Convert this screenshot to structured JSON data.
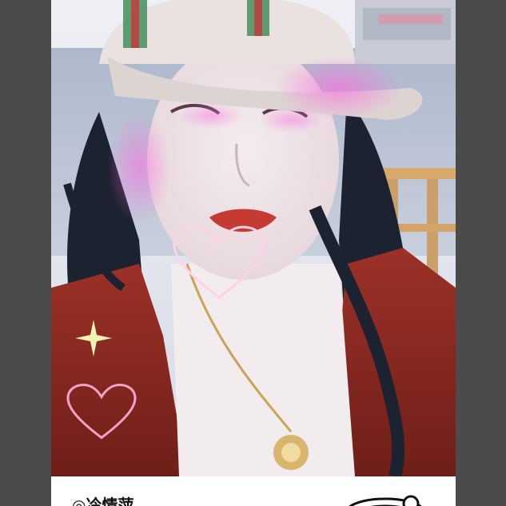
{
  "caption": {
    "text": "◎冷情萍"
  },
  "colors": {
    "outer_background": "#4a4b4a",
    "card_background": "#ffffff",
    "jacket": "#8c2a22",
    "hair": "#1c2230",
    "heart_glitter": "#ff4fd8"
  },
  "icons": {
    "badge": "ornament-badge-icon",
    "hearts": "heart-icon",
    "sparkle": "sparkle-icon"
  }
}
